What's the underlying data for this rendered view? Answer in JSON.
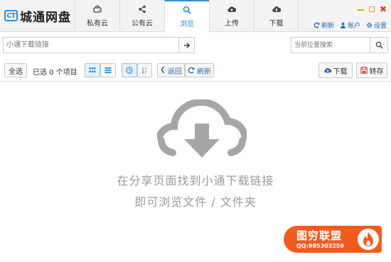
{
  "app": {
    "logo_badge": "CT",
    "logo_text": "城通网盘"
  },
  "tabs": [
    {
      "label": "私有云",
      "icon": "drive-icon"
    },
    {
      "label": "公有云",
      "icon": "share-icon"
    },
    {
      "label": "浏览",
      "icon": "search-icon",
      "active": true
    },
    {
      "label": "上传",
      "icon": "cloud-upload-icon"
    },
    {
      "label": "下载",
      "icon": "cloud-download-icon"
    }
  ],
  "header_actions": {
    "refresh": "刷新",
    "account": "账户",
    "settings": "设置"
  },
  "address": {
    "placeholder": "小通下载链接"
  },
  "search": {
    "placeholder": "当前位置搜索"
  },
  "toolbar": {
    "select_all": "全选",
    "selected_count": "已选 0 个项目",
    "back": "返回",
    "refresh": "刷新",
    "download": "下载",
    "save_to": "转存"
  },
  "empty_state": {
    "line1": "在分享页面找到小通下载链接",
    "line2": "即可浏览文件 / 文件夹"
  },
  "watermark": {
    "title": "图穷联盟",
    "qq": "QQ:985303259"
  },
  "colors": {
    "accent": "#2d8fd6",
    "header_bg": "#f3f3f3",
    "empty_icon": "#a6a6a6",
    "watermark": "#f25b1f",
    "danger": "#e23b2e"
  }
}
